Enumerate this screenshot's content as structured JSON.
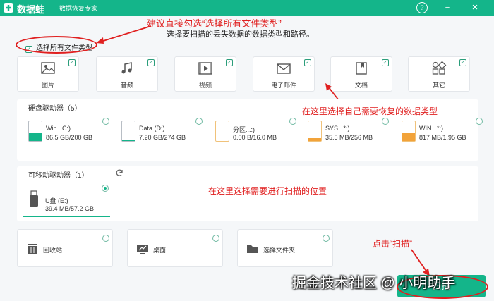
{
  "titlebar": {
    "app_name": "数据蛙",
    "subtitle": "数据恢复专家",
    "help_icon": "?",
    "minimize_icon": "−",
    "close_icon": "×",
    "bg_color": "#14b58a"
  },
  "annotations": {
    "top": "建议直接勾选“选择所有文件类型”",
    "types": "在这里选择自己需要恢复的数据类型",
    "location": "在这里选择需要进行扫描的位置",
    "scan": "点击“扫描”",
    "color": "#e02020"
  },
  "header": {
    "instruction": "选择要扫描的丢失数据的数据类型和路径。",
    "select_all_label": "选择所有文件类型",
    "select_all_checked": true
  },
  "file_types": [
    {
      "label": "图片",
      "icon": "image-icon",
      "checked": true
    },
    {
      "label": "音频",
      "icon": "audio-icon",
      "checked": true
    },
    {
      "label": "视频",
      "icon": "video-icon",
      "checked": true
    },
    {
      "label": "电子邮件",
      "icon": "email-icon",
      "checked": true
    },
    {
      "label": "文档",
      "icon": "document-icon",
      "checked": true
    },
    {
      "label": "其它",
      "icon": "other-icon",
      "checked": true
    }
  ],
  "hard_drives": {
    "label": "硬盘驱动器（5）",
    "items": [
      {
        "name": "Win...C:)",
        "size": "86.5 GB/200 GB",
        "usage": 0.43,
        "color": "#14b58a"
      },
      {
        "name": "Data (D:)",
        "size": "7.20 GB/274 GB",
        "usage": 0.03,
        "color": "#14b58a"
      },
      {
        "name": "分区...:)",
        "size": "0.00  B/16.0 MB",
        "usage": 0.0,
        "color": "#f2a33a"
      },
      {
        "name": "SYS...*:)",
        "size": "35.5 MB/256 MB",
        "usage": 0.14,
        "color": "#f2a33a"
      },
      {
        "name": "WIN...*:)",
        "size": "817 MB/1.95 GB",
        "usage": 0.42,
        "color": "#f2a33a"
      }
    ]
  },
  "removable_drives": {
    "label": "可移动驱动器（1）",
    "refresh_icon": "refresh-icon",
    "items": [
      {
        "name": "U盘 (E:)",
        "size": "39.4 MB/57.2 GB",
        "selected": true
      }
    ]
  },
  "locations": [
    {
      "label": "回收站",
      "icon": "recycle-bin-icon"
    },
    {
      "label": "桌面",
      "icon": "desktop-icon"
    },
    {
      "label": "选择文件夹",
      "icon": "folder-icon"
    }
  ],
  "scan_button": {
    "label": "扫描"
  },
  "watermark": "掘金技术社区 @ 小明助手"
}
